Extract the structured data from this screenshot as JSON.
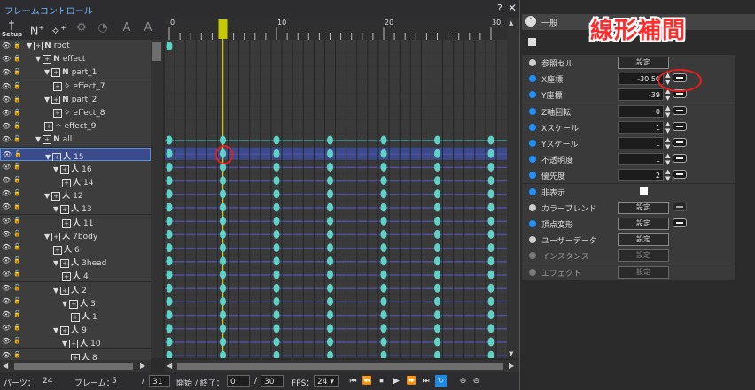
{
  "window": {
    "title": "フレームコントロール",
    "help": "?",
    "close": "✕"
  },
  "toolbar": {
    "setup_label": "Setup"
  },
  "tree": {
    "rows": [
      {
        "label": "root",
        "icon": "N",
        "indent": 1,
        "expander": "▼"
      },
      {
        "label": "effect",
        "icon": "N",
        "indent": 2,
        "expander": "▼"
      },
      {
        "label": "part_1",
        "icon": "N",
        "indent": 3,
        "expander": "▼"
      },
      {
        "label": "effect_7",
        "icon": "✧",
        "indent": 4,
        "expander": ""
      },
      {
        "label": "part_2",
        "icon": "N",
        "indent": 3,
        "expander": "▼"
      },
      {
        "label": "effect_8",
        "icon": "✧",
        "indent": 4,
        "expander": ""
      },
      {
        "label": "effect_9",
        "icon": "✧",
        "indent": 3,
        "expander": ""
      },
      {
        "label": "all",
        "icon": "N",
        "indent": 2,
        "expander": "▼"
      },
      {
        "label": "15",
        "icon": "人",
        "indent": 3,
        "expander": "▼",
        "selected": true
      },
      {
        "label": "16",
        "icon": "人",
        "indent": 4,
        "expander": "▼"
      },
      {
        "label": "14",
        "icon": "人",
        "indent": 5,
        "expander": ""
      },
      {
        "label": "12",
        "icon": "人",
        "indent": 3,
        "expander": "▼"
      },
      {
        "label": "13",
        "icon": "人",
        "indent": 4,
        "expander": "▼"
      },
      {
        "label": "11",
        "icon": "人",
        "indent": 5,
        "expander": ""
      },
      {
        "label": "7body",
        "icon": "人",
        "indent": 3,
        "expander": "▼"
      },
      {
        "label": "6",
        "icon": "人",
        "indent": 4,
        "expander": ""
      },
      {
        "label": "3head",
        "icon": "人",
        "indent": 4,
        "expander": "▼"
      },
      {
        "label": "4",
        "icon": "人",
        "indent": 5,
        "expander": ""
      },
      {
        "label": "2",
        "icon": "人",
        "indent": 4,
        "expander": "▼"
      },
      {
        "label": "3",
        "icon": "人",
        "indent": 5,
        "expander": "▼"
      },
      {
        "label": "1",
        "icon": "人",
        "indent": 6,
        "expander": ""
      },
      {
        "label": "9",
        "icon": "人",
        "indent": 4,
        "expander": "▼"
      },
      {
        "label": "10",
        "icon": "人",
        "indent": 5,
        "expander": "▼"
      },
      {
        "label": "8",
        "icon": "人",
        "indent": 6,
        "expander": ""
      }
    ]
  },
  "timeline": {
    "ruler_labels": [
      "0",
      "10",
      "20",
      "30"
    ],
    "current_frame": 5,
    "total_frames": 31,
    "keyframe_frames": [
      0,
      5,
      10,
      15,
      20,
      25,
      30
    ]
  },
  "status": {
    "parts_label": "パーツ：",
    "parts_count": "24",
    "frame_label": "フレーム：",
    "frame_value": "5",
    "frame_total": "31",
    "slash": "/",
    "start_end_label": "開始 / 終了：",
    "start": "0",
    "end": "30",
    "fps_label": "FPS：",
    "fps": "24 ▾"
  },
  "playback": [
    "⏮",
    "⏪",
    "⏹",
    "▶",
    "⏩",
    "⏭",
    "↻",
    "⊕",
    "⊖"
  ],
  "inspector": {
    "section": "一般",
    "rows": [
      {
        "label": "参照セル",
        "dot": "#cfcfcf",
        "type": "button",
        "value": "設定"
      },
      {
        "label": "X座標",
        "dot": "#1e90ff",
        "type": "number",
        "value": "-30.50",
        "interp": true
      },
      {
        "label": "Y座標",
        "dot": "#1e90ff",
        "type": "number",
        "value": "-39",
        "interp": true
      },
      {
        "label": "Z軸回転",
        "dot": "#1e90ff",
        "type": "number",
        "value": "0",
        "interp": true
      },
      {
        "label": "Xスケール",
        "dot": "#1e90ff",
        "type": "number",
        "value": "1",
        "interp": true
      },
      {
        "label": "Yスケール",
        "dot": "#1e90ff",
        "type": "number",
        "value": "1",
        "interp": true
      },
      {
        "label": "不透明度",
        "dot": "#1e90ff",
        "type": "number",
        "value": "1",
        "interp": true
      },
      {
        "label": "優先度",
        "dot": "#1e90ff",
        "type": "number",
        "value": "2",
        "interp": true
      },
      {
        "label": "非表示",
        "dot": "#1e90ff",
        "type": "checkbox"
      },
      {
        "label": "カラーブレンド",
        "dot": "#cfcfcf",
        "type": "button",
        "value": "設定",
        "interp_dim": true
      },
      {
        "label": "頂点変形",
        "dot": "#1e90ff",
        "type": "button",
        "value": "設定",
        "interp": true
      },
      {
        "label": "ユーザーデータ",
        "dot": "#cfcfcf",
        "type": "button",
        "value": "設定"
      },
      {
        "label": "インスタンス",
        "dot": "#777",
        "type": "button",
        "value": "設定",
        "dim": true
      },
      {
        "label": "エフェクト",
        "dot": "#777",
        "type": "button",
        "value": "設定",
        "dim": true
      }
    ]
  },
  "annotation": {
    "text": "線形補間"
  },
  "colors": {
    "keyframe": "#5fd2c6",
    "playhead": "#c8c800",
    "selected_row": "#3b4a8a"
  }
}
